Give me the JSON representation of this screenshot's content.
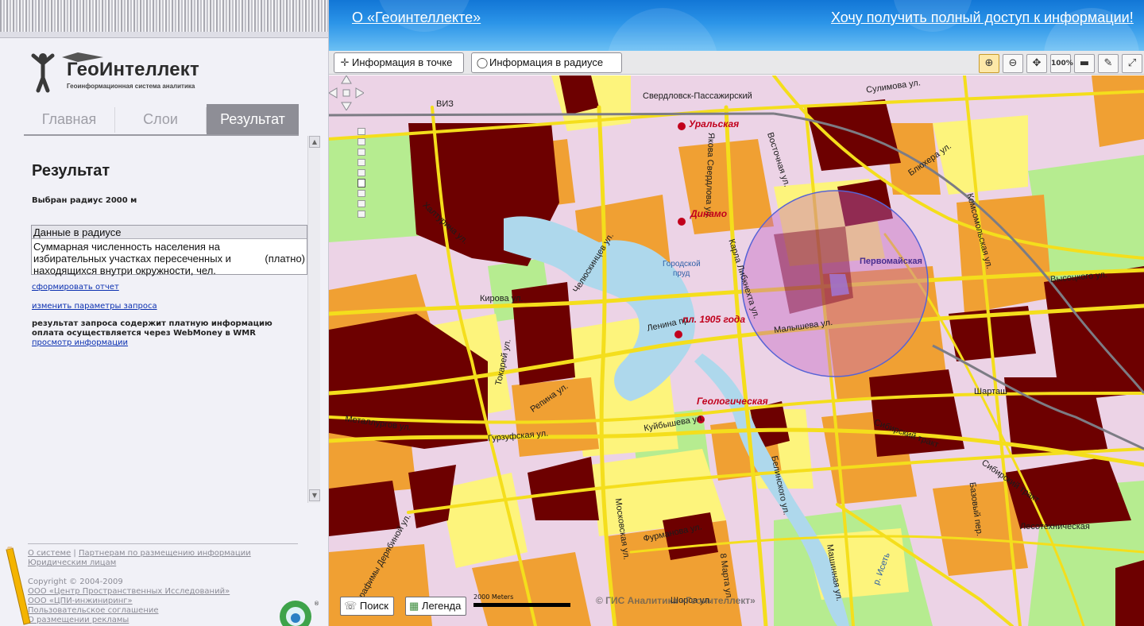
{
  "header": {
    "about_link": "О «Геоинтеллекте»",
    "access_link": "Хочу получить полный доступ к информации!"
  },
  "logo": {
    "name": "ГеоИнтеллект",
    "tagline": "Геоинформационная система аналитика"
  },
  "tabs": [
    {
      "label": "Главная",
      "active": false
    },
    {
      "label": "Слои",
      "active": false
    },
    {
      "label": "Результат",
      "active": true
    }
  ],
  "result": {
    "title": "Результат",
    "radius_text": "Выбран радиус 2000 м",
    "table_header": "Данные в радиусе",
    "row_description": "Суммарная численность населения на избирательных участках пересеченных и находящихся внутри окружности, чел.",
    "row_value": "(платно)",
    "report_link": "сформировать отчет",
    "change_params_link": "изменить параметры запроса",
    "paid_notice_1": "результат запроса содержит платную информацию",
    "paid_notice_2": "оплата осуществляется через WebMoney в WMR",
    "view_info_link": "просмотр информации"
  },
  "footer": {
    "about": "О системе",
    "separator": "|",
    "partners": "Партнерам по размещению информации",
    "legal": "Юридическим лицам",
    "copyright": "Copyright © 2004-2009",
    "org1": "ООО «Центр Пространственных Исследований»",
    "org2": "ООО «ЦПИ-инжиниринг»",
    "agreement": "Пользовательское соглашение",
    "ads": "О размещении рекламы"
  },
  "toolbar": {
    "point_info": "Информация в точке",
    "radius_info": "Информация в радиусе",
    "zoom_100": "100%",
    "icons": [
      "zoom-in-icon",
      "zoom-out-icon",
      "pan-icon",
      "zoom-100-icon",
      "ruler-icon",
      "pencil-icon",
      "fullscreen-icon"
    ]
  },
  "map": {
    "search_button": "Поиск",
    "legend_button": "Легенда",
    "scale_label": "2000 Meters",
    "copyright": "© ГИС Аналитика «Геоинтеллект»",
    "pond_label_1": "Городской",
    "pond_label_2": "пруд",
    "labels": {
      "viz": "ВИЗ",
      "railway_station": "Свердловск-Пассажирский",
      "sulimova": "Сулимова ул.",
      "blyukhera": "Блюхера ул.",
      "komsomolskaya": "Комсомольская ул.",
      "vostochnaya": "Восточная ул.",
      "sverdlova": "Якова Свердлова ул.",
      "khalturina": "Халтурина ул.",
      "chelyuskintsev": "Челюскинцев ул.",
      "karla_libknekhta": "Карла Либкнехта ул.",
      "pervomayskaya": "Первомайская",
      "vysotsky": "Высоцкого ул.",
      "kirova": "Кирова ул.",
      "lenina": "Ленина пр.",
      "malysheva": "Малышева ул.",
      "tokarey": "Токарей ул.",
      "repina": "Репина ул.",
      "shartash": "Шарташ",
      "metallurgov": "Металлургов ул.",
      "gurzufskaya": "Гурзуфская ул.",
      "kuybysheva": "Куйбышева ул.",
      "sibirsky_1": "Сибирский тракт",
      "sibirsky_2": "Сибирский тракт",
      "belinskogo": "Белинского ул.",
      "moskovskaya": "Московская ул.",
      "bazovy": "Базовый пер.",
      "lesotekhnicheskaya": "Лесотехническая",
      "furmanova": "Фурманова ул.",
      "vos_marta": "8 Марта ул.",
      "mashinnaya": "Машинная ул.",
      "iset": "р. Исеть",
      "derabinoy": "Серафимы Дерябиной ул.",
      "shorsa": "Шорса ул."
    },
    "stations": {
      "uralskaya": "Уральская",
      "dinamo": "Динамо",
      "ploshchad": "пл. 1905 года",
      "geologicheskaya": "Геологическая"
    },
    "colors": {
      "very_high": "#6d0000",
      "high": "#f0a033",
      "medium": "#fdf47c",
      "low": "#e9cde3",
      "green": "#b4ec8f",
      "water": "#aed8ec",
      "road": "#f4de1c",
      "radius_circle": "#5663d6"
    }
  }
}
